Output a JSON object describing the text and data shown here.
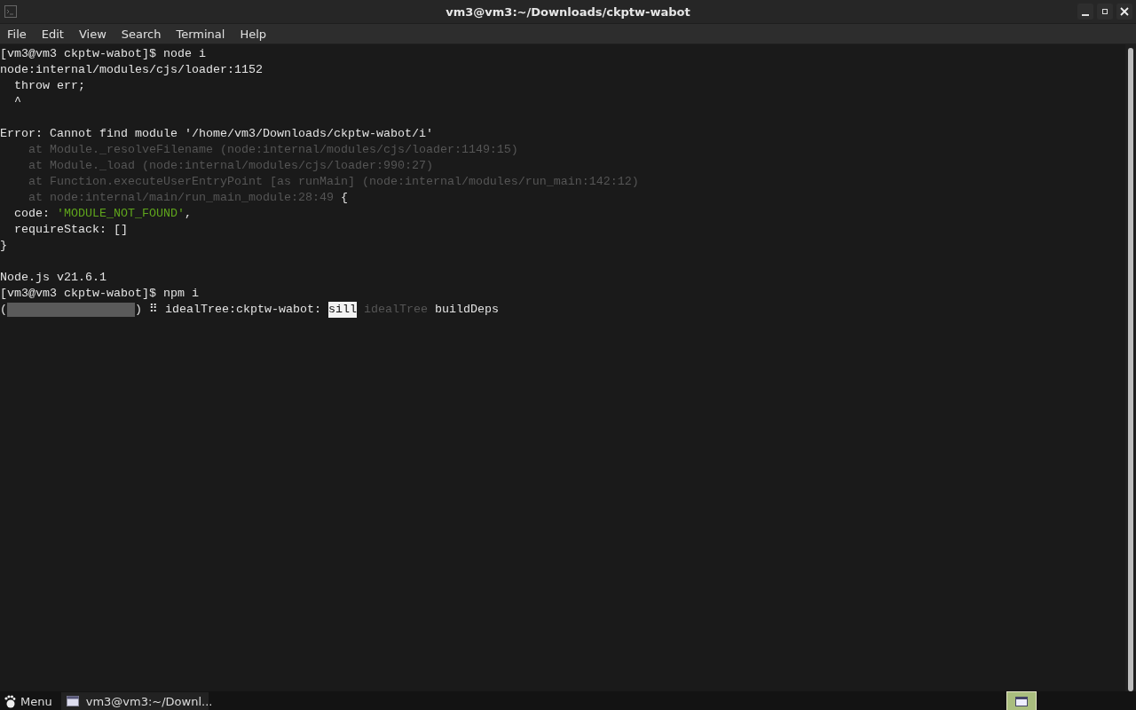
{
  "window": {
    "title": "vm3@vm3:~/Downloads/ckptw-wabot"
  },
  "menu": [
    "File",
    "Edit",
    "View",
    "Search",
    "Terminal",
    "Help"
  ],
  "terminal": {
    "lines": [
      {
        "kind": "text",
        "segments": [
          {
            "kind": "normal",
            "text": "[vm3@vm3 ckptw-wabot]$ node i"
          }
        ]
      },
      {
        "kind": "text",
        "segments": [
          {
            "kind": "normal",
            "text": "node:internal/modules/cjs/loader:1152"
          }
        ]
      },
      {
        "kind": "text",
        "segments": [
          {
            "kind": "normal",
            "text": "  throw err;"
          }
        ]
      },
      {
        "kind": "text",
        "segments": [
          {
            "kind": "normal",
            "text": "  ^"
          }
        ]
      },
      {
        "kind": "blank"
      },
      {
        "kind": "text",
        "segments": [
          {
            "kind": "normal",
            "text": "Error: Cannot find module '/home/vm3/Downloads/ckptw-wabot/i'"
          }
        ]
      },
      {
        "kind": "text",
        "segments": [
          {
            "kind": "dim",
            "text": "    at Module._resolveFilename (node:internal/modules/cjs/loader:1149:15)"
          }
        ]
      },
      {
        "kind": "text",
        "segments": [
          {
            "kind": "dim",
            "text": "    at Module._load (node:internal/modules/cjs/loader:990:27)"
          }
        ]
      },
      {
        "kind": "text",
        "segments": [
          {
            "kind": "dim",
            "text": "    at Function.executeUserEntryPoint [as runMain] (node:internal/modules/run_main:142:12)"
          }
        ]
      },
      {
        "kind": "text",
        "segments": [
          {
            "kind": "dim",
            "text": "    at node:internal/main/run_main_module:28:49"
          },
          {
            "kind": "normal",
            "text": " {"
          }
        ]
      },
      {
        "kind": "text",
        "segments": [
          {
            "kind": "normal",
            "text": "  code: "
          },
          {
            "kind": "green",
            "text": "'MODULE_NOT_FOUND'"
          },
          {
            "kind": "normal",
            "text": ","
          }
        ]
      },
      {
        "kind": "text",
        "segments": [
          {
            "kind": "normal",
            "text": "  requireStack: []"
          }
        ]
      },
      {
        "kind": "text",
        "segments": [
          {
            "kind": "normal",
            "text": "}"
          }
        ]
      },
      {
        "kind": "blank"
      },
      {
        "kind": "text",
        "segments": [
          {
            "kind": "normal",
            "text": "Node.js v21.6.1"
          }
        ]
      },
      {
        "kind": "text",
        "segments": [
          {
            "kind": "normal",
            "text": "[vm3@vm3 ckptw-wabot]$ npm i"
          }
        ]
      },
      {
        "kind": "progress",
        "segments": [
          {
            "kind": "normal",
            "text": "("
          },
          {
            "kind": "gauge"
          },
          {
            "kind": "normal",
            "text": ")"
          },
          {
            "kind": "normal",
            "text": "⠿"
          },
          {
            "kind": "normal",
            "text": "idealTree:ckptw-wabot:"
          },
          {
            "kind": "highlight",
            "text": "sill"
          },
          {
            "kind": "dim",
            "text": "idealTree"
          },
          {
            "kind": "normal",
            "text": "buildDeps"
          }
        ]
      }
    ]
  },
  "taskbar": {
    "menu_label": "Menu",
    "tasks": [
      {
        "label": "vm3@vm3:~/Downl...",
        "selected": false
      }
    ]
  }
}
